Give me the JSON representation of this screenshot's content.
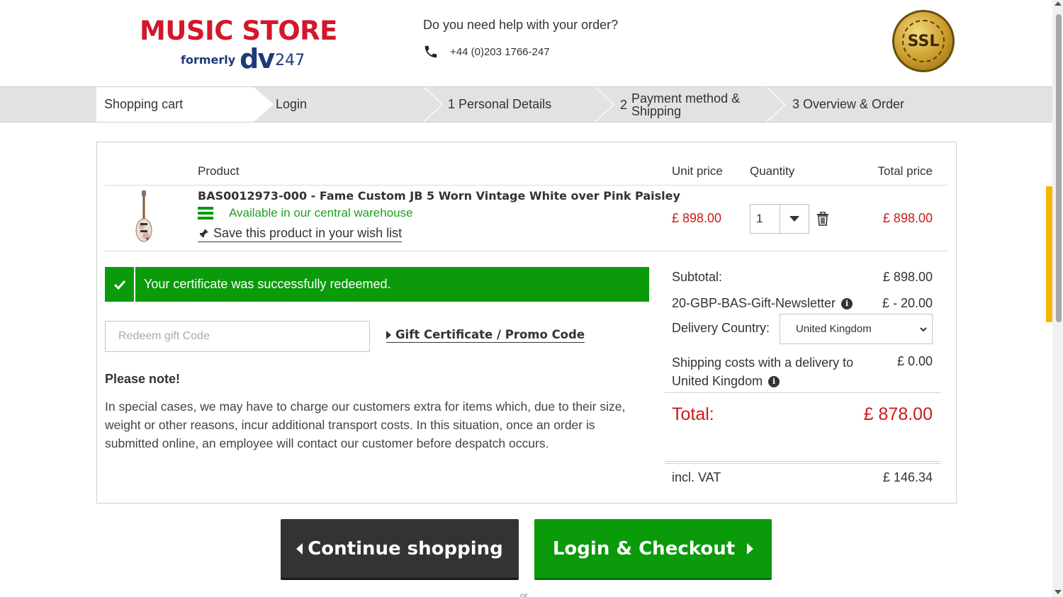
{
  "header": {
    "logo_main": "MUSIC STORE",
    "logo_formerly": "formerly",
    "logo_dv": "dv",
    "logo_247": "247",
    "help_text": "Do you need help with your order?",
    "phone": "+44 (0)203 1766-247",
    "ssl_label": "SSL"
  },
  "steps": [
    {
      "label": "Shopping cart"
    },
    {
      "label": "Login"
    },
    {
      "label": "1 Personal Details"
    },
    {
      "num": "2",
      "label": "Payment method & Shipping"
    },
    {
      "label": "3 Overview & Order"
    }
  ],
  "cart": {
    "headers": {
      "product": "Product",
      "unit_price": "Unit price",
      "quantity": "Quantity",
      "total_price": "Total price"
    },
    "item": {
      "title": "BAS0012973-000 - Fame Custom JB 5 Worn Vintage White over Pink Paisley",
      "availability": "Available in our central warehouse",
      "wish_list": "Save this product in your wish list",
      "unit_price": "£ 898.00",
      "quantity": "1",
      "total_price": "£ 898.00"
    },
    "success_message": "Your certificate was successfully redeemed.",
    "gift_placeholder": "Redeem gift Code",
    "gift_link": "Gift Certificate / Promo Code",
    "note_title": "Please note!",
    "note_body": "In special cases, we may have to charge our customers extra for items which, due to their size, weight or other reasons, incur additional transport costs. In this situation, once an order is submitted online, an employee will contact our customer before despatch occurs.",
    "summary": {
      "subtotal_label": "Subtotal:",
      "subtotal_value": "£ 898.00",
      "voucher_label": "20-GBP-BAS-Gift-Newsletter",
      "voucher_value": "£ - 20.00",
      "delivery_country_label": "Delivery Country:",
      "delivery_country_value": "United Kingdom",
      "shipping_label_1": "Shipping costs with a delivery to",
      "shipping_label_2": "United Kingdom",
      "shipping_value": "£ 0.00",
      "total_label": "Total:",
      "total_value": "£ 878.00",
      "vat_label": "incl. VAT",
      "vat_value": "£ 146.34"
    }
  },
  "buttons": {
    "continue": "Continue shopping",
    "checkout": "Login & Checkout",
    "or": "or"
  },
  "colors": {
    "brand_red": "#d2182a",
    "price_red": "#cc1a1a",
    "success_green": "#0a9a0a",
    "dark_button": "#333333"
  }
}
